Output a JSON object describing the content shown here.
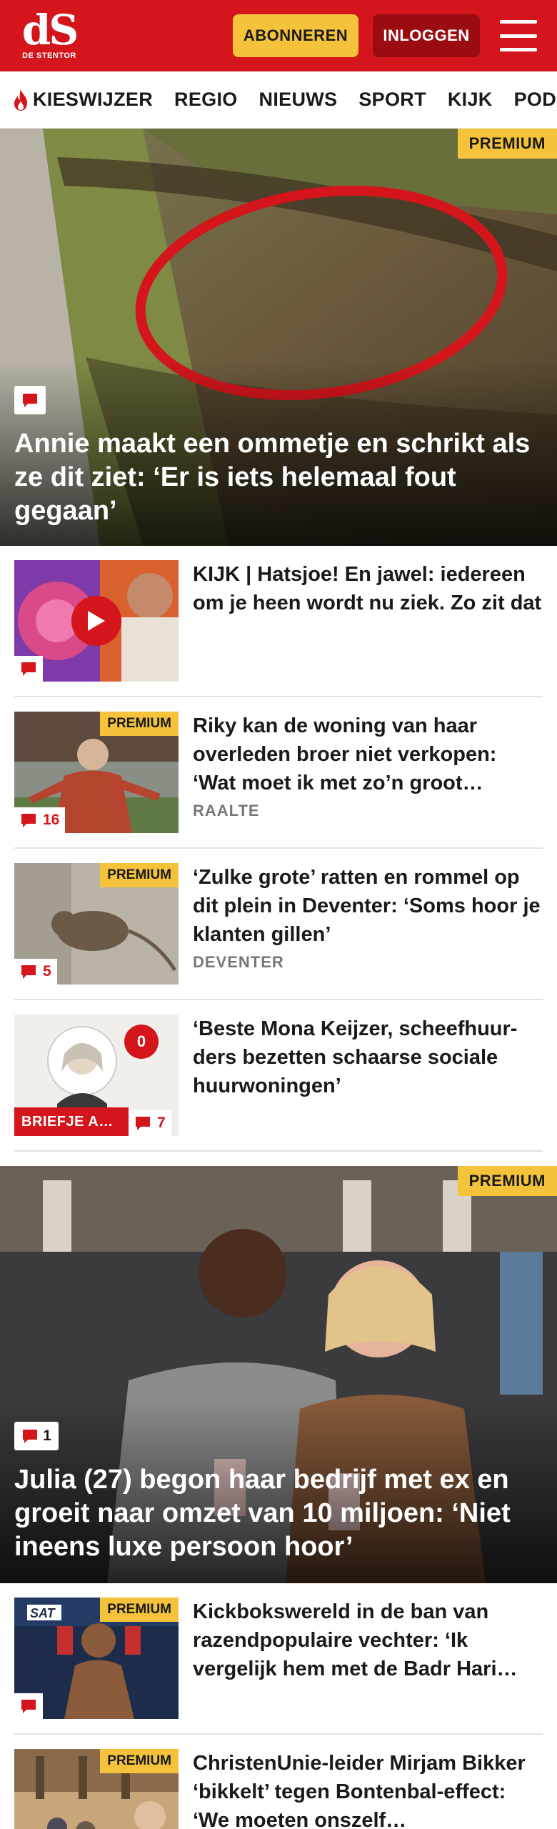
{
  "header": {
    "logo_mark": "dS",
    "logo_name": "DE STENTOR",
    "subscribe_label": "ABONNEREN",
    "login_label": "INLOGGEN"
  },
  "nav": {
    "items": [
      "KIESWIJZER",
      "REGIO",
      "NIEUWS",
      "SPORT",
      "KIJK",
      "PODCAST"
    ]
  },
  "labels": {
    "premium": "PREMIUM"
  },
  "hero1": {
    "title": "Annie maakt een ommetje en schrikt als ze dit ziet: ‘Er is iets helemaal fout gegaan’",
    "premium": true
  },
  "articles1": [
    {
      "title": "KIJK | Hatsjoe! En jawel: iedereen om je heen wordt nu ziek. Zo zit dat",
      "comments": "",
      "location": "",
      "premium": false
    },
    {
      "title": "Riky kan de woning van haar overleden broer niet verkopen: ‘Wat moet ik met zo’n groot…",
      "comments": "16",
      "location": "RAALTE",
      "premium": true
    },
    {
      "title": "‘Zulke grote’ ratten en rommel op dit plein in Deventer: ‘Soms hoor je klanten gillen’",
      "comments": "5",
      "location": "DEVENTER",
      "premium": true
    },
    {
      "title": "‘Beste Mona Keijzer, scheefhuur-ders bezetten schaarse sociale huurwoningen’",
      "comments": "7",
      "location": "",
      "premium": false,
      "category": "BRIEFJE A…",
      "badge": "0"
    }
  ],
  "hero2": {
    "title": "Julia (27) begon haar bedrijf met ex en groeit naar omzet van 10 miljoen: ‘Niet ineens luxe persoon hoor’",
    "comments": "1",
    "premium": true
  },
  "articles2": [
    {
      "title": "Kickbokswereld in de ban van razendpopulaire vechter: ‘Ik vergelijk hem met de Badr Hari…",
      "premium": true,
      "thumb_text": "SAT"
    },
    {
      "title": "ChristenUnie-leider Mirjam Bikker ‘bikkelt’ tegen Bontenbal-effect: ‘We moeten onszelf…",
      "premium": true
    }
  ],
  "colors": {
    "brand_red": "#d4151c",
    "premium_yellow": "#f5c33b",
    "login_dark_red": "#9a0c12"
  }
}
